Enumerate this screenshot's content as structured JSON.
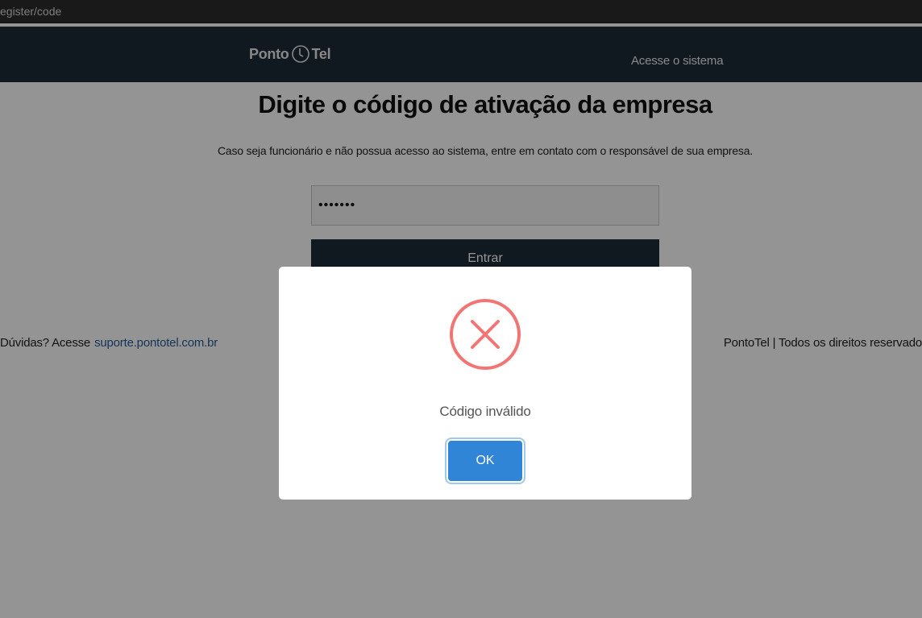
{
  "browser": {
    "url_fragment": "egister/code"
  },
  "header": {
    "logo_left": "Ponto",
    "logo_right": "Tel",
    "nav_link": "Acesse o sistema"
  },
  "main": {
    "title": "Digite o código de ativação da empresa",
    "subtitle": "Caso seja funcionário e não possua acesso ao sistema, entre em contato com o responsável de sua empresa.",
    "code_value": "•••••••",
    "enter_label": "Entrar"
  },
  "footer": {
    "help_prefix": "Dúvidas? Acesse",
    "help_link": "suporte.pontotel.com.br",
    "rights": "PontoTel | Todos os direitos reservado"
  },
  "dialog": {
    "icon": "error-x-icon",
    "message": "Código inválido",
    "ok_label": "OK"
  },
  "colors": {
    "header_bg": "#1e2b37",
    "error_icon": "#f27474",
    "ok_button": "#3085d6",
    "link": "#2a5c9a"
  }
}
